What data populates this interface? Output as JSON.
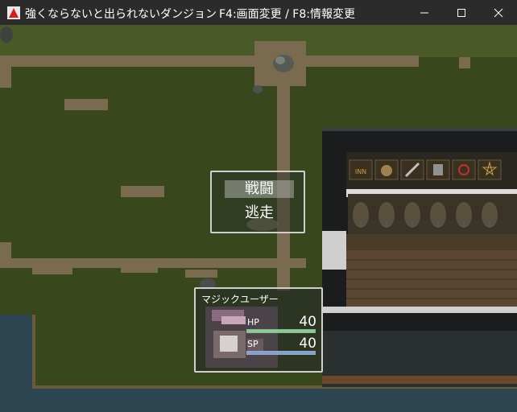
{
  "window": {
    "title": "強くならないと出られないダンジョン",
    "hint": "F4:画面変更 / F8:情報変更",
    "controls": [
      "minimize-icon",
      "maximize-icon",
      "close-icon"
    ]
  },
  "colors": {
    "grass": "#3d4a1e",
    "path": "#7a6b50",
    "water": "#2e4652",
    "building_roof": "#1a1c1e",
    "hp_bar": "#7fd48a",
    "sp_bar": "#7f9fe0"
  },
  "shop_sign_icons": [
    "inn-sign-icon",
    "item-bag-icon",
    "weapon-sword-icon",
    "armor-icon",
    "magic-ring-icon",
    "spell-star-icon"
  ],
  "command_menu": {
    "items": [
      {
        "label": "戦闘",
        "selected": true
      },
      {
        "label": "逃走",
        "selected": false
      }
    ]
  },
  "status": {
    "name": "マジックユーザー",
    "hp": {
      "label": "HP",
      "value": "40",
      "fill": 1.0
    },
    "sp": {
      "label": "SP",
      "value": "40",
      "fill": 1.0
    }
  }
}
